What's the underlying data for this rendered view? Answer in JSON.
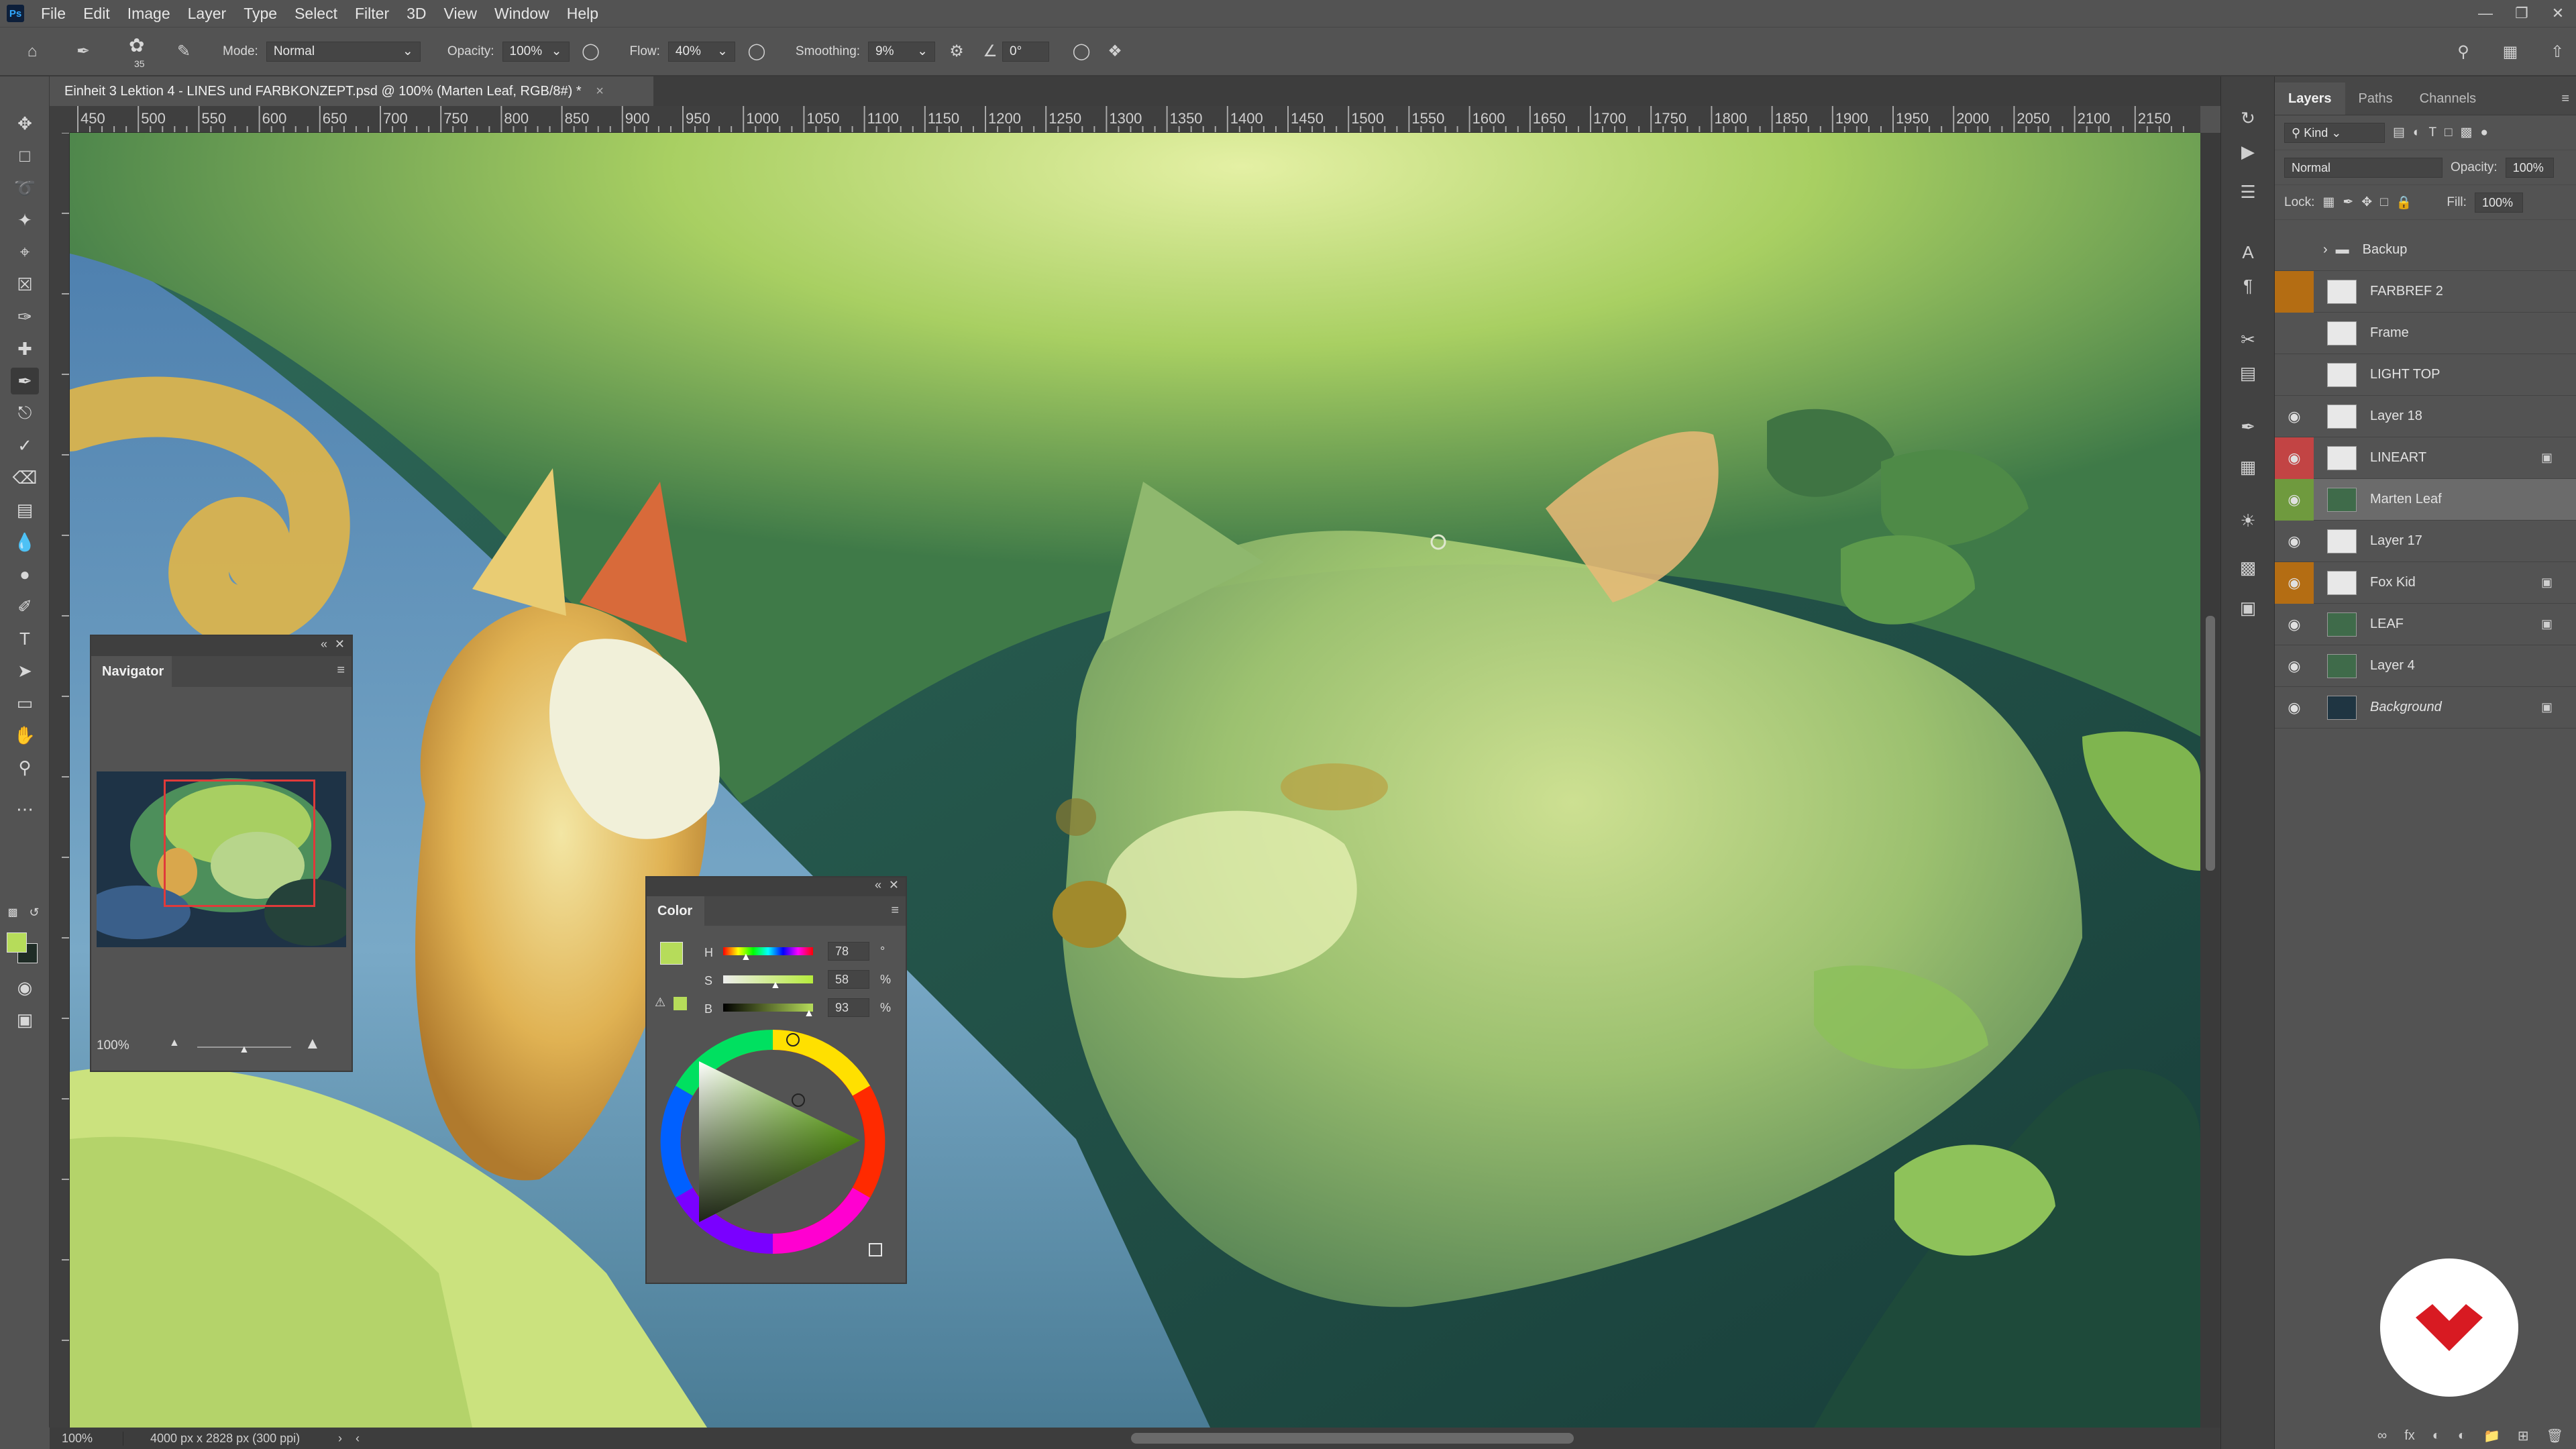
{
  "menu": {
    "app_icon": "Ps",
    "items": [
      "File",
      "Edit",
      "Image",
      "Layer",
      "Type",
      "Select",
      "Filter",
      "3D",
      "View",
      "Window",
      "Help"
    ]
  },
  "options": {
    "brush_size": "35",
    "mode_label": "Mode:",
    "mode_value": "Normal",
    "opacity_label": "Opacity:",
    "opacity_value": "100%",
    "flow_label": "Flow:",
    "flow_value": "40%",
    "smoothing_label": "Smoothing:",
    "smoothing_value": "9%",
    "angle_value": "0°"
  },
  "document": {
    "tab_title": "Einheit 3 Lektion 4 - LINES und FARBKONZEPT.psd @ 100% (Marten Leaf, RGB/8#) *",
    "close": "×"
  },
  "ruler": {
    "top_labels": [
      "450",
      "500",
      "550",
      "600",
      "650",
      "700",
      "750",
      "800",
      "850",
      "900",
      "950",
      "1000",
      "1050",
      "1100",
      "1150",
      "1200",
      "1250",
      "1300",
      "1350",
      "1400",
      "1450",
      "1500",
      "1550",
      "1600",
      "1650",
      "1700",
      "1750",
      "1800",
      "1850",
      "1900",
      "1950",
      "2000",
      "2050",
      "2100",
      "2150"
    ]
  },
  "status": {
    "zoom": "100%",
    "doc_info": "4000 px x 2828 px (300 ppi)"
  },
  "navigator": {
    "title": "Navigator",
    "zoom": "100%"
  },
  "color_panel": {
    "title": "Color",
    "h_label": "H",
    "h_value": "78",
    "h_unit": "°",
    "s_label": "S",
    "s_value": "58",
    "s_unit": "%",
    "b_label": "B",
    "b_value": "93",
    "b_unit": "%",
    "foreground": "#b6dc5a",
    "background": "#1f2c26"
  },
  "layers_panel": {
    "tabs": [
      "Layers",
      "Paths",
      "Channels"
    ],
    "filter_kind": "Kind",
    "blend_mode": "Normal",
    "opacity_label": "Opacity:",
    "opacity_value": "100%",
    "lock_label": "Lock:",
    "fill_label": "Fill:",
    "fill_value": "100%",
    "layers": [
      {
        "name": "Backup",
        "visible": false,
        "tag": "",
        "group": true,
        "locked": false
      },
      {
        "name": "FARBREF 2",
        "visible": false,
        "tag": "#b46d13",
        "group": false,
        "locked": false
      },
      {
        "name": "Frame",
        "visible": false,
        "tag": "",
        "group": false,
        "locked": false
      },
      {
        "name": "LIGHT TOP",
        "visible": false,
        "tag": "",
        "group": false,
        "locked": false
      },
      {
        "name": "Layer 18",
        "visible": true,
        "tag": "",
        "group": false,
        "locked": false
      },
      {
        "name": "LINEART",
        "visible": true,
        "tag": "#c24444",
        "group": false,
        "locked": true
      },
      {
        "name": "Marten Leaf",
        "visible": true,
        "tag": "#6f9a3e",
        "group": false,
        "locked": false,
        "selected": true
      },
      {
        "name": "Layer 17",
        "visible": true,
        "tag": "",
        "group": false,
        "locked": false
      },
      {
        "name": "Fox Kid",
        "visible": true,
        "tag": "#b46d13",
        "group": false,
        "locked": true
      },
      {
        "name": "LEAF",
        "visible": true,
        "tag": "",
        "group": false,
        "locked": true
      },
      {
        "name": "Layer 4",
        "visible": true,
        "tag": "",
        "group": false,
        "locked": false
      },
      {
        "name": "Background",
        "visible": true,
        "tag": "",
        "group": false,
        "locked": true
      }
    ]
  },
  "accent": {
    "selection_red": "#e03a3a",
    "watermark_red": "#d81a22"
  }
}
